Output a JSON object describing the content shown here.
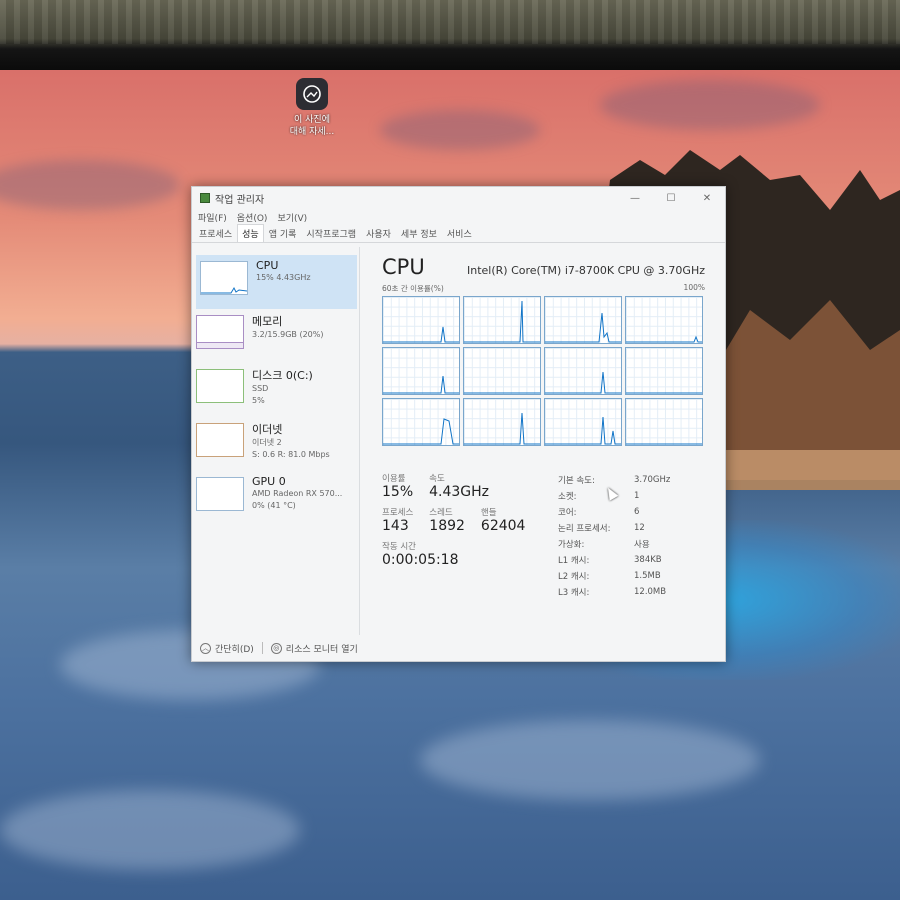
{
  "desktop_icon": {
    "label_line1": "이 사진에",
    "label_line2": "대해 자세..."
  },
  "window": {
    "title": "작업 관리자",
    "controls": {
      "minimize": "—",
      "maximize": "☐",
      "close": "✕"
    },
    "menu": [
      "파일(F)",
      "옵션(O)",
      "보기(V)"
    ],
    "tabs": [
      "프로세스",
      "성능",
      "앱 기록",
      "시작프로그램",
      "사용자",
      "세부 정보",
      "서비스"
    ],
    "active_tab": "성능"
  },
  "sidebar": {
    "items": [
      {
        "name": "CPU",
        "sub1": "15% 4.43GHz",
        "sub2": ""
      },
      {
        "name": "메모리",
        "sub1": "3.2/15.9GB (20%)",
        "sub2": ""
      },
      {
        "name": "디스크 0(C:)",
        "sub1": "SSD",
        "sub2": "5%"
      },
      {
        "name": "이더넷",
        "sub1": "이더넷 2",
        "sub2": "S: 0.6  R: 81.0 Mbps"
      },
      {
        "name": "GPU 0",
        "sub1": "AMD Radeon RX 570...",
        "sub2": "0% (41 °C)"
      }
    ]
  },
  "cpu": {
    "title": "CPU",
    "model": "Intel(R) Core(TM) i7-8700K CPU @ 3.70GHz",
    "graph_caption": "60초 간 이용률(%)",
    "graph_max": "100%",
    "utilization_label": "이용률",
    "utilization": "15%",
    "speed_label": "속도",
    "speed": "4.43GHz",
    "processes_label": "프로세스",
    "processes": "143",
    "threads_label": "스레드",
    "threads": "1892",
    "handles_label": "핸들",
    "handles": "62404",
    "uptime_label": "작동 시간",
    "uptime": "0:00:05:18",
    "details": [
      {
        "k": "기본 속도:",
        "v": "3.70GHz"
      },
      {
        "k": "소켓:",
        "v": "1"
      },
      {
        "k": "코어:",
        "v": "6"
      },
      {
        "k": "논리 프로세서:",
        "v": "12"
      },
      {
        "k": "가상화:",
        "v": "사용"
      },
      {
        "k": "L1 캐시:",
        "v": "384KB"
      },
      {
        "k": "L2 캐시:",
        "v": "1.5MB"
      },
      {
        "k": "L3 캐시:",
        "v": "12.0MB"
      }
    ]
  },
  "footer": {
    "collapse": "간단히(D)",
    "monitor": "리소스 모니터 열기"
  },
  "colors": {
    "accent": "#1174c7",
    "selection": "#cfe3f5",
    "graph_border": "#7aa6cc"
  }
}
